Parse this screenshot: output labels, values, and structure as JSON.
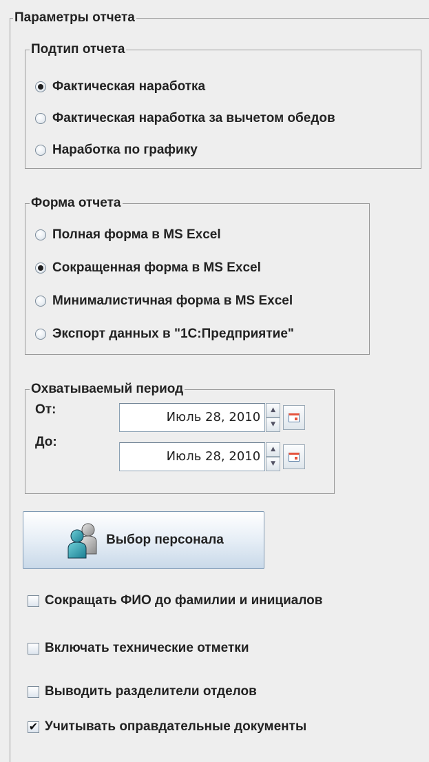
{
  "main_group": {
    "legend": "Параметры отчета"
  },
  "subtype_group": {
    "legend": "Подтип отчета",
    "options": [
      {
        "label": "Фактическая наработка",
        "selected": true
      },
      {
        "label": "Фактическая наработка за вычетом обедов",
        "selected": false
      },
      {
        "label": "Наработка по графику",
        "selected": false
      }
    ]
  },
  "form_group": {
    "legend": "Форма отчета",
    "options": [
      {
        "label": "Полная форма в MS Excel",
        "selected": false
      },
      {
        "label": "Сокращенная форма в MS Excel",
        "selected": true
      },
      {
        "label": "Минималистичная форма в MS Excel",
        "selected": false
      },
      {
        "label": "Экспорт данных в \"1С:Предприятие\"",
        "selected": false
      }
    ]
  },
  "period_group": {
    "legend": "Охватываемый период",
    "from_label": "От:",
    "from_value": "Июль 28, 2010",
    "to_label": "До:",
    "to_value": "Июль 28, 2010"
  },
  "personnel_button": {
    "label": "Выбор персонала",
    "icon": "people-icon"
  },
  "checkboxes": [
    {
      "label": "Сокращать ФИО до фамилии и инициалов",
      "checked": false
    },
    {
      "label": "Включать технические отметки",
      "checked": false
    },
    {
      "label": "Выводить разделители отделов",
      "checked": false
    },
    {
      "label": "Учитывать оправдательные документы",
      "checked": true
    }
  ],
  "icons": {
    "spin_up": "▲",
    "spin_down": "▼",
    "check_mark": "✔",
    "calendar": "calendar-icon"
  },
  "colors": {
    "background": "#eeeeee",
    "button_blue": "#c9d9e9",
    "calendar_red": "#e5533d"
  }
}
